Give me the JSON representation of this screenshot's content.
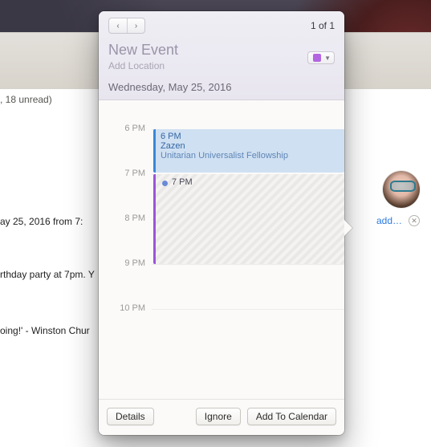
{
  "background": {
    "unread_text": ", 18 unread)",
    "mail_date_line": "ay 25, 2016 from 7:",
    "body_snip_1": "rthday party at 7pm. Y",
    "body_snip_2": "oing!' - Winston Chur",
    "add_label": "add…"
  },
  "popover": {
    "page_indicator": "1 of 1",
    "title": "New Event",
    "location_placeholder": "Add Location",
    "date_line": "Wednesday, May 25, 2016",
    "calendar_color": "#b266e0",
    "hours": [
      "6 PM",
      "7 PM",
      "8 PM",
      "9 PM",
      "10 PM"
    ],
    "existing_event": {
      "start_label": "6 PM",
      "title": "Zazen",
      "location": "Unitarian Universalist Fellowship"
    },
    "suggested_event": {
      "dot_color": "#6a8ad6",
      "start_label": "7 PM"
    },
    "buttons": {
      "details": "Details",
      "ignore": "Ignore",
      "add": "Add To Calendar"
    }
  }
}
